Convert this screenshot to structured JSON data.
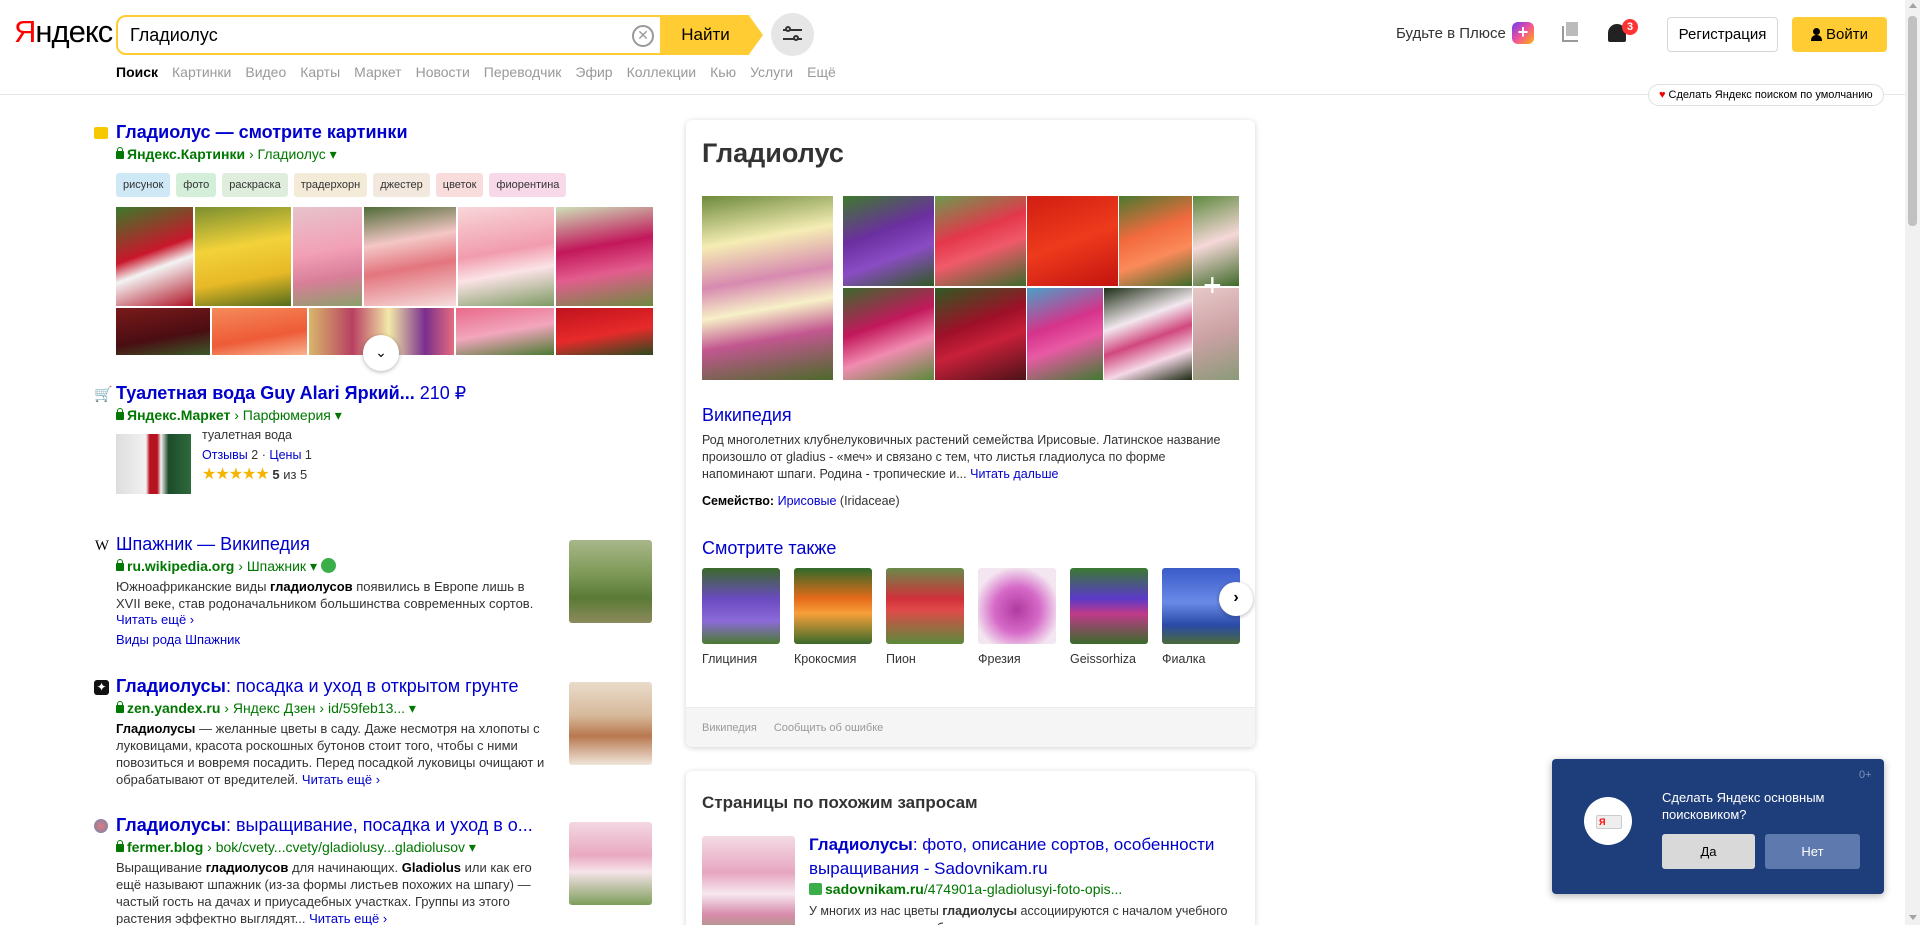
{
  "header": {
    "logo": "Яндекс",
    "search_value": "Гладиолус",
    "search_button": "Найти",
    "plus_link": "Будьте в Плюсе",
    "plus_icon_glyph": "+",
    "notification_count": "3",
    "register_button": "Регистрация",
    "login_button": "Войти",
    "make_default": "Сделать Яндекс поиском по умолчанию"
  },
  "nav": {
    "tabs": [
      "Поиск",
      "Картинки",
      "Видео",
      "Карты",
      "Маркет",
      "Новости",
      "Переводчик",
      "Эфир",
      "Коллекции",
      "Кью",
      "Услуги",
      "Ещё"
    ]
  },
  "results": {
    "images": {
      "title": "Гладиолус — смотрите картинки",
      "url_site": "Яндекс.Картинки",
      "url_path": "Гладиолус",
      "tags": [
        "рисунок",
        "фото",
        "раскраска",
        "традерхорн",
        "джестер",
        "цветок",
        "фиорентина"
      ]
    },
    "market": {
      "title": "Туалетная вода Guy Alari Яркий...",
      "price": "210 ₽",
      "url_site": "Яндекс.Маркет",
      "url_path": "Парфюмерия",
      "category": "туалетная вода",
      "reviews_label": "Отзывы",
      "reviews_count": "2",
      "prices_label": "Цены",
      "prices_count": "1",
      "rating": "5",
      "rating_max": "из 5"
    },
    "wiki": {
      "title": "Шпажник — Википедия",
      "url_site": "ru.wikipedia.org",
      "url_path": "Шпажник",
      "text_a": "Южноафриканские виды ",
      "text_b": "гладиолусов",
      "text_c": " появились в Европе лишь в XVII веке, став родоначальником большинства современных сортов.",
      "read_more": "Читать ещё ›",
      "sublink": "Виды рода Шпажник"
    },
    "zen": {
      "title_bold": "Гладиолусы",
      "title_rest": ": посадка и уход в открытом грунте",
      "url_site": "zen.yandex.ru",
      "url_path": "Яндекс Дзен › id/59feb13...",
      "text_b": "Гладиолусы",
      "text_c": " — желанные цветы в саду. Даже несмотря на хлопоты с луковицами, красота роскошных бутонов стоит того, чтобы с ними повозиться и вовремя посадить. Перед посадкой луковицы очищают и обрабатывают от вредителей.",
      "read_more": "Читать ещё ›"
    },
    "fermer": {
      "title_bold": "Гладиолусы",
      "title_rest": ": выращивание, посадка и уход в о...",
      "url_site": "fermer.blog",
      "url_path": "bok/cvety...cvety/gladiolusy...gladiolusov",
      "text_a": "Выращивание ",
      "text_b": "гладиолусов",
      "text_c": " для начинающих. ",
      "text_d": "Gladiolus",
      "text_e": " или как его ещё называют шпажник (из-за формы листьев похожих на шпагу) — частый гость на дачах и приусадебных участках. Группы из этого растения эффектно выглядят...",
      "read_more": "Читать ещё ›"
    }
  },
  "panel": {
    "title": "Гладиолус",
    "wiki_title": "Википедия",
    "wiki_text": "Род многолетних клубнелуковичных растений семейства Ирисовые. Латинское название произошло от gladius - «меч» и связано с тем, что листья гладиолуса по форме напоминают шпаги. Родина - тропические и...",
    "read_further": "Читать дальше",
    "family_label": "Семейство:",
    "family_value": "Ирисовые",
    "family_latin": "(Iridaceae)",
    "see_also_title": "Смотрите также",
    "see_also": [
      "Глициния",
      "Крокосмия",
      "Пион",
      "Фрезия",
      "Geissorhiza",
      "Фиалка"
    ],
    "footer_source": "Википедия",
    "footer_report": "Сообщить об ошибке"
  },
  "related": {
    "title": "Страницы по похожим запросам",
    "item_title_bold": "Гладиолусы",
    "item_title_rest": ": фото, описание сортов, особенности выращивания - Sadovnikam.ru",
    "item_url_site": "sadovnikam.ru",
    "item_url_path": "/474901a-gladiolusyi-foto-opis...",
    "item_text_a": "У многих из нас цветы ",
    "item_text_b": "гладиолусы",
    "item_text_c": " ассоциируются с началом учебного года и праздничными букетами."
  },
  "popup": {
    "counter": "0+",
    "text": "Сделать Яндекс основным поисковиком?",
    "yes": "Да",
    "no": "Нет"
  },
  "colors": {
    "accent_yellow": "#ffcc33",
    "link_blue": "#0000cc",
    "url_green": "#007700",
    "popup_bg": "#1e3d7b"
  },
  "icons": {
    "images": "image-icon",
    "market": "cart-icon",
    "wiki": "wikipedia-icon",
    "zen": "zen-icon",
    "fermer": "site-favicon"
  }
}
